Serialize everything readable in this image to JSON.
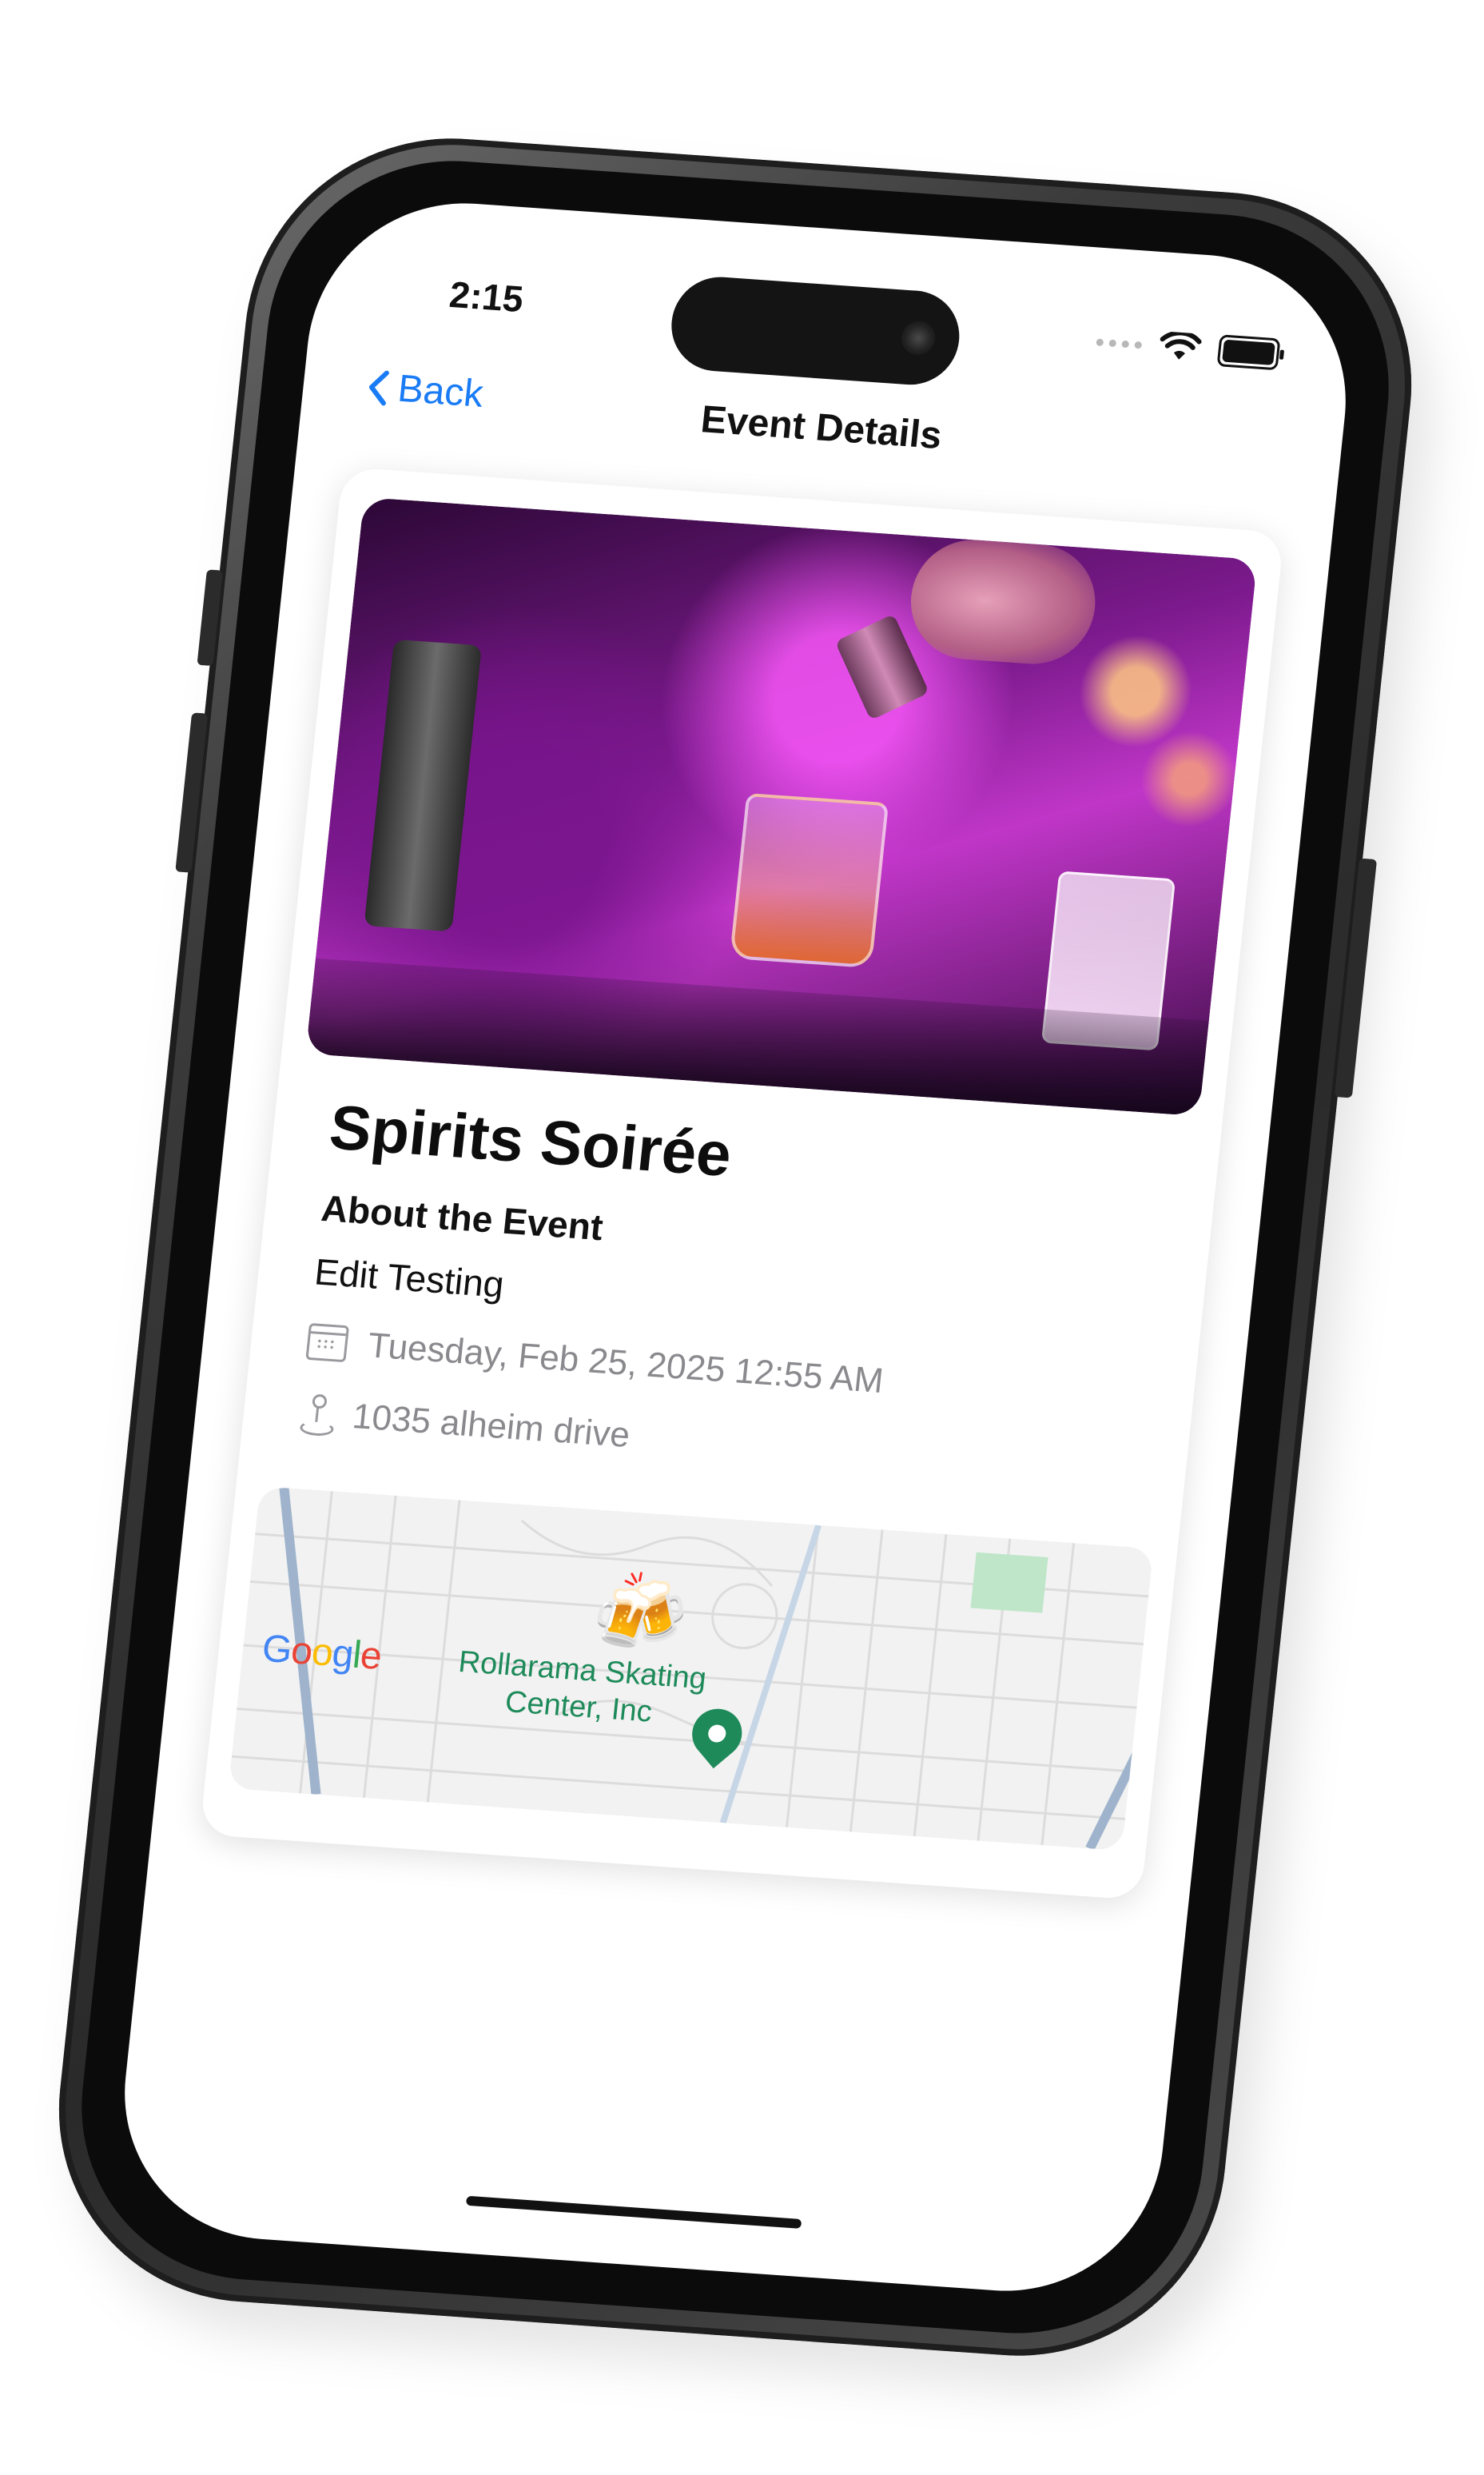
{
  "status_bar": {
    "time": "2:15"
  },
  "nav": {
    "back_label": "Back",
    "title": "Event Details"
  },
  "event": {
    "title": "Spirits Soirée",
    "about_heading": "About the Event",
    "description": "Edit Testing",
    "date": "Tuesday, Feb 25, 2025 12:55 AM",
    "location": "1035 alheim drive"
  },
  "map": {
    "provider_logo": [
      "G",
      "o",
      "o",
      "g",
      "l",
      "e"
    ],
    "place_name_line1": "Rollarama Skating",
    "place_name_line2": "Center, Inc",
    "marker_icon": "beer-mugs-icon",
    "pin_color": "#1e8a5a"
  },
  "icons": {
    "back": "chevron-left-icon",
    "date": "calendar-icon",
    "location": "map-pin-icon"
  },
  "colors": {
    "accent": "#1a7cf5",
    "secondary_text": "#8a8a8e"
  }
}
